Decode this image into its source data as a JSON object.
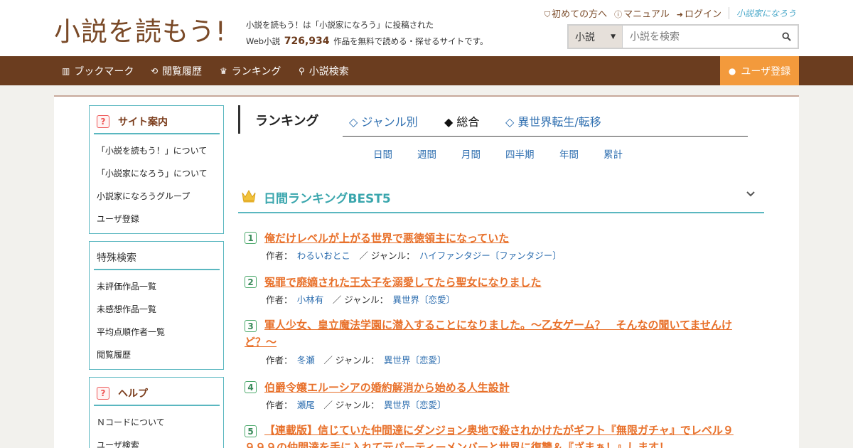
{
  "header": {
    "logo": "小説を読もう!",
    "tagline_line1": "小説を読もう！は「小説家になろう」に投稿された",
    "tagline_prefix": "Web小説",
    "work_count": "726,934",
    "tagline_suffix": "作品を無料で読める・探せるサイトです。",
    "links": [
      {
        "icon": "beginner-icon",
        "label": "初めての方へ"
      },
      {
        "icon": "question-icon",
        "label": "マニュアル"
      },
      {
        "icon": "login-icon",
        "label": "ログイン"
      }
    ],
    "brand_link": "小説家になろう",
    "search": {
      "select_value": "小説",
      "placeholder": "小説を検索"
    }
  },
  "nav": {
    "items": [
      {
        "icon": "bookmark-icon",
        "label": "ブックマーク"
      },
      {
        "icon": "history-icon",
        "label": "閲覧履歴"
      },
      {
        "icon": "crown-icon",
        "label": "ランキング"
      },
      {
        "icon": "search-icon",
        "label": "小説検索"
      }
    ],
    "register": "ユーザ登録"
  },
  "sidebar": {
    "site_guide": {
      "title": "サイト案内",
      "items": [
        "「小説を読もう！」について",
        "「小説家になろう」について",
        "小説家になろうグループ",
        "ユーザ登録"
      ]
    },
    "special_search": {
      "title": "特殊検索",
      "items": [
        "未評価作品一覧",
        "未感想作品一覧",
        "平均点順作者一覧",
        "閲覧履歴"
      ]
    },
    "help": {
      "title": "ヘルプ",
      "items": [
        "Ｎコードについて",
        "ユーザ検索"
      ]
    }
  },
  "ranking": {
    "title": "ランキング",
    "tabs": [
      {
        "label": "◇ ジャンル別",
        "current": false
      },
      {
        "label": "◆ 総合",
        "current": true
      },
      {
        "label": "◇ 異世界転生/転移",
        "current": false
      }
    ],
    "periods": [
      "日間",
      "週間",
      "月間",
      "四半期",
      "年間",
      "累計"
    ],
    "best_title": "日間ランキングBEST5",
    "author_label": "作者：",
    "genre_label": "／ ジャンル：",
    "entries": [
      {
        "rank": "1",
        "title": "俺だけレベルが上がる世界で悪徳領主になっていた",
        "author": "わるいおとこ",
        "genre": "ハイファンタジー〔ファンタジー〕"
      },
      {
        "rank": "2",
        "title": "冤罪で廃嫡された王太子を溺愛してたら聖女になりました",
        "author": "小林有",
        "genre": "異世界〔恋愛〕"
      },
      {
        "rank": "3",
        "title": "軍人少女、皇立魔法学園に潜入することになりました。～乙女ゲーム？　そんなの聞いてませんけど？～",
        "author": "冬瀬",
        "genre": "異世界〔恋愛〕"
      },
      {
        "rank": "4",
        "title": "伯爵令嬢エルーシアの婚約解消から始める人生設計",
        "author": "瀬尾",
        "genre": "異世界〔恋愛〕"
      },
      {
        "rank": "5",
        "title": "【連載版】信じていた仲間達にダンジョン奥地で殺されかけたがギフト『無限ガチャ』でレベル９９９９の仲間達を手に入れて元パーティーメンバーと世界に復讐＆『ざまぁ！』します！",
        "author": "",
        "genre": ""
      }
    ]
  },
  "colors": {
    "brand_brown": "#6b3d1f",
    "accent_orange": "#f39a3c",
    "teal": "#5ab7c0",
    "title_orange": "#e8702a",
    "link_blue": "#2f6fb0"
  }
}
